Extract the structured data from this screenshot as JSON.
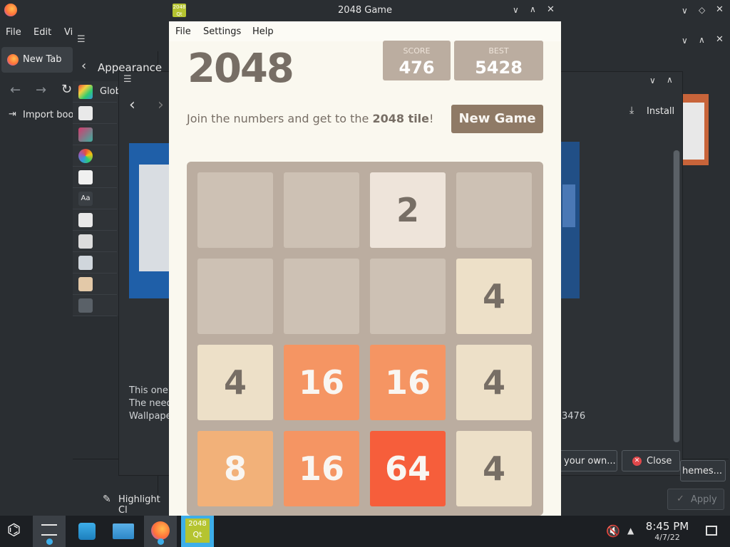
{
  "firefox": {
    "menu": [
      "File",
      "Edit",
      "Vi"
    ],
    "tab_label": "New Tab",
    "import_label": "Import boo"
  },
  "settings": {
    "page_title": "Appearance",
    "global_label": "Glob",
    "highlight_label": "Highlight Cl"
  },
  "themes_dialog": {
    "install_label": "Install",
    "description_lines": [
      "This one's",
      "The need",
      "Wallpape"
    ],
    "side_number": "3476",
    "your_own_label": "your own...",
    "close_label": "Close",
    "themes_label": "hemes...",
    "apply_label": "Apply"
  },
  "game": {
    "window_title": "2048 Game",
    "menu": [
      "File",
      "Settings",
      "Help"
    ],
    "title": "2048",
    "score_label": "SCORE",
    "score": "476",
    "best_label": "BEST",
    "best": "5428",
    "subtitle_prefix": "Join the numbers and get to the ",
    "subtitle_bold": "2048 tile",
    "subtitle_suffix": "!",
    "new_game_label": "New Game",
    "grid": [
      [
        0,
        0,
        2,
        0
      ],
      [
        0,
        0,
        0,
        4
      ],
      [
        4,
        16,
        16,
        4
      ],
      [
        8,
        16,
        64,
        4
      ]
    ],
    "colors": {
      "background": "#faf8ef",
      "board": "#bbada0",
      "empty": "#cdc1b4",
      "tile_2": "#eee4da",
      "tile_4": "#ede0c8",
      "tile_8": "#f2b179",
      "tile_16": "#f59563",
      "tile_64": "#f65e3b",
      "button": "#8f7a66"
    }
  },
  "taskbar": {
    "apps": [
      "launcher-icon",
      "system-settings-icon",
      "discover-icon",
      "dolphin-icon",
      "firefox-icon",
      "qt-2048-icon"
    ],
    "qt_label_top": "2048",
    "qt_label_bottom": "Qt",
    "time": "8:45 PM",
    "date": "4/7/22"
  }
}
